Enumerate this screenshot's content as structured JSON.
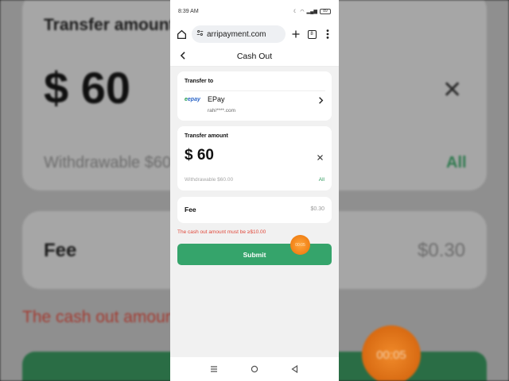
{
  "status": {
    "time": "8:39 AM",
    "battery": "89"
  },
  "browser": {
    "url": "arripayment.com",
    "tab_count": "8"
  },
  "page": {
    "title": "Cash Out"
  },
  "transfer_to": {
    "label": "Transfer to",
    "method_logo": "epay",
    "method_name": "EPay",
    "account": "rahi****.com"
  },
  "transfer_amount": {
    "label": "Transfer amount",
    "amount": "$ 60",
    "withdrawable": "Withdrawable $60.00",
    "all_label": "All"
  },
  "fee": {
    "label": "Fee",
    "value": "$0.30"
  },
  "error": "The cash out amount must be ≥$10.00",
  "submit_label": "Submit",
  "timer": {
    "small": "00:05",
    "large": "00:05"
  },
  "background": {
    "transfer_label": "Transfer amount",
    "amount": "$ 60",
    "withdrawable": "Withdrawable $60",
    "all_label": "All",
    "fee_label": "Fee",
    "fee_value": "$0.30",
    "error": "The cash out amoun"
  },
  "colors": {
    "accent": "#35a46b",
    "error": "#e0483a",
    "timer": "#f07f14"
  }
}
